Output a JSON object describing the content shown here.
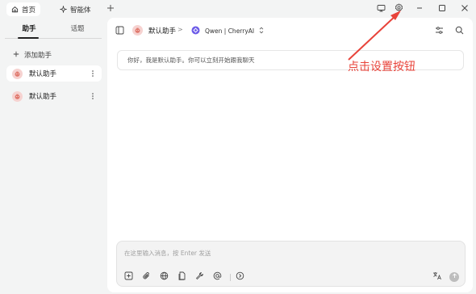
{
  "topbar": {
    "tabs": [
      {
        "label": "首页",
        "icon": "home-icon",
        "active": true
      },
      {
        "label": "智能体",
        "icon": "sparkle-icon",
        "active": false
      }
    ],
    "new_tab_icon": "plus-icon",
    "right_icons": [
      "monitor-icon",
      "gear-icon",
      "minimize-icon",
      "maximize-icon",
      "close-icon"
    ]
  },
  "sidebar": {
    "tabs": [
      {
        "label": "助手",
        "active": true
      },
      {
        "label": "话题",
        "active": false
      }
    ],
    "add_label": "添加助手",
    "assistants": [
      {
        "name": "默认助手",
        "active": true
      },
      {
        "name": "默认助手",
        "active": false
      }
    ]
  },
  "header": {
    "assistant_name": "默认助手",
    "separator": ">",
    "model_label": "Qwen | CherryAI",
    "right_icons": [
      "settings-sliders-icon",
      "search-icon"
    ]
  },
  "chat": {
    "greeting": "你好，我是默认助手。你可以立刻开始跟我聊天"
  },
  "composer": {
    "placeholder": "在这里输入消息，按 Enter 发送",
    "tools": [
      "new-topic-icon",
      "attachment-icon",
      "web-search-icon",
      "knowledge-icon",
      "mcp-tools-icon",
      "mention-icon",
      "more-icon"
    ],
    "translate_icon": "translate-icon",
    "send_icon": "send-icon"
  },
  "annotation": {
    "text": "点击设置按钮",
    "color": "#e8433a"
  }
}
